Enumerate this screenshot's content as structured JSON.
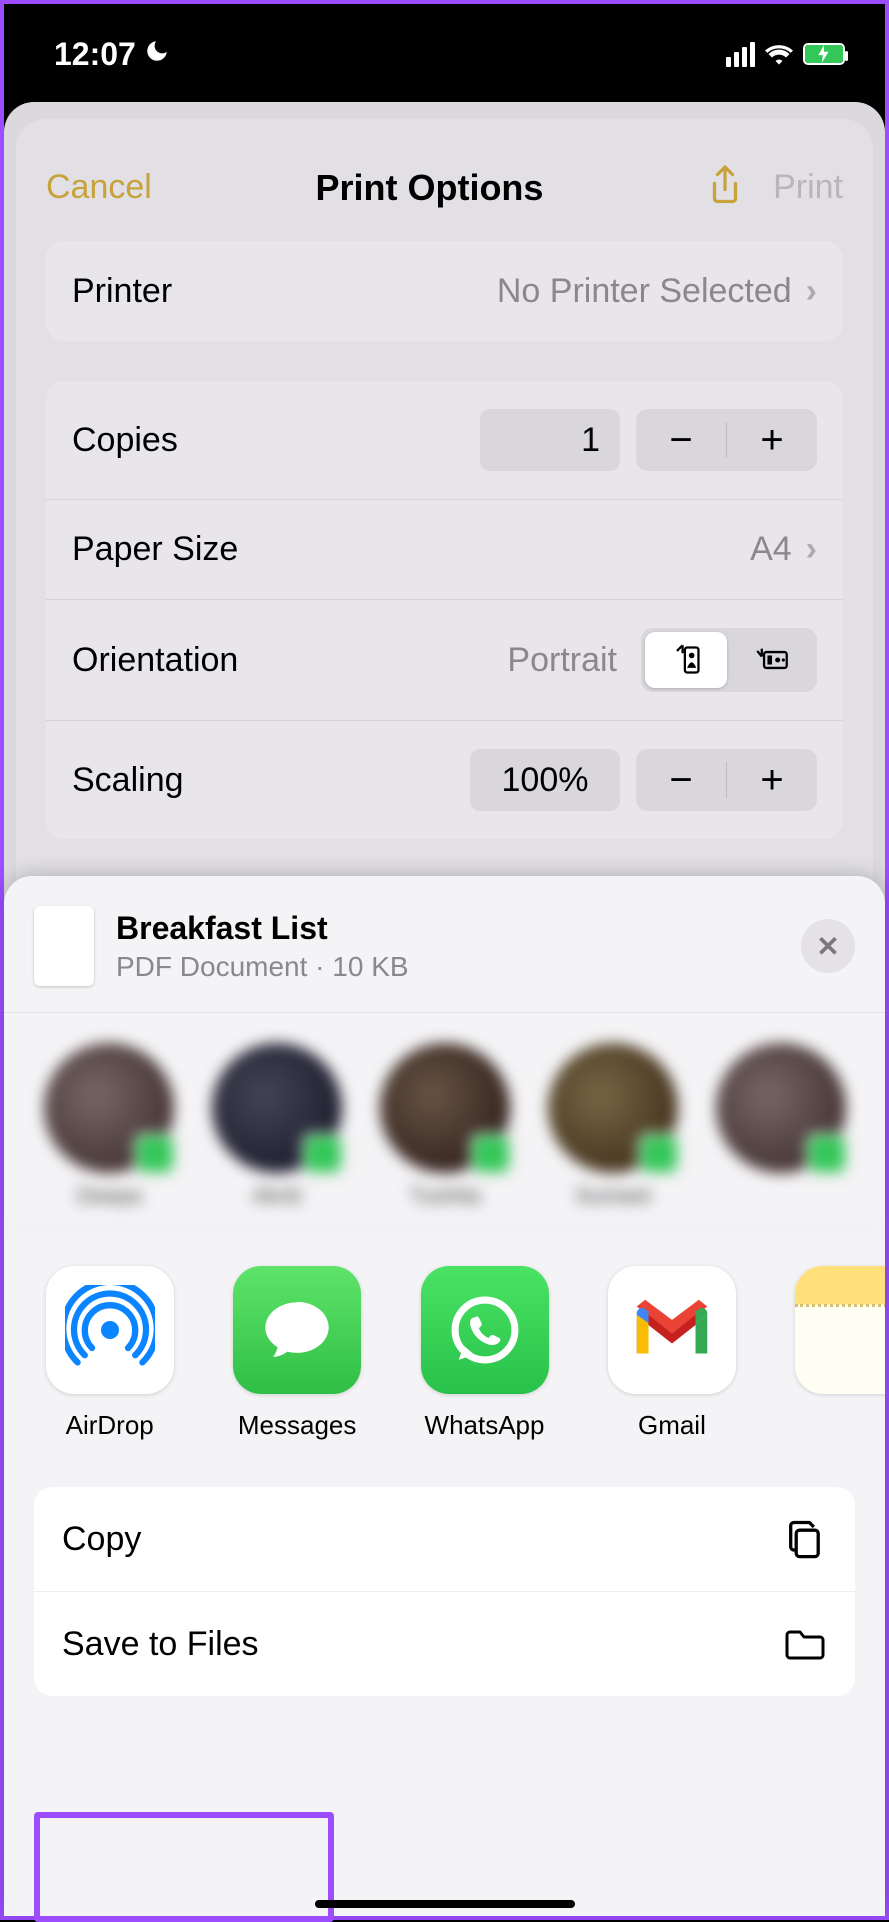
{
  "status": {
    "time": "12:07"
  },
  "print": {
    "cancel": "Cancel",
    "title": "Print Options",
    "print_label": "Print",
    "printer_label": "Printer",
    "printer_value": "No Printer Selected",
    "copies_label": "Copies",
    "copies_value": "1",
    "paper_label": "Paper Size",
    "paper_value": "A4",
    "orientation_label": "Orientation",
    "orientation_value": "Portrait",
    "scaling_label": "Scaling",
    "scaling_value": "100%"
  },
  "share": {
    "doc_title": "Breakfast List",
    "doc_subtitle": "PDF Document · 10 KB",
    "apps": {
      "airdrop": "AirDrop",
      "messages": "Messages",
      "whatsapp": "WhatsApp",
      "gmail": "Gmail"
    },
    "actions": {
      "copy": "Copy",
      "save_to_files": "Save to Files"
    }
  }
}
